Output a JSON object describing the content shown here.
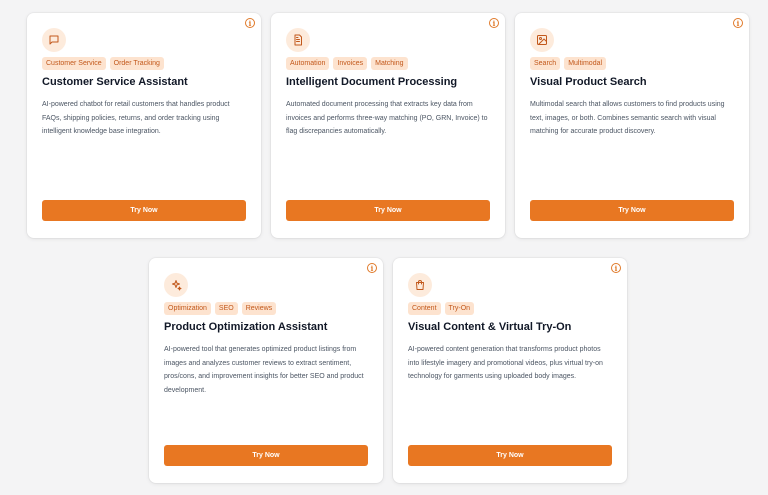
{
  "cards": [
    {
      "icon": "chat-bubble-icon",
      "tags": [
        "Customer Service",
        "Order Tracking"
      ],
      "title": "Customer Service Assistant",
      "description": "AI-powered chatbot for retail customers that handles product FAQs, shipping policies, returns, and order tracking using intelligent knowledge base integration.",
      "button": "Try Now",
      "info": "i"
    },
    {
      "icon": "document-icon",
      "tags": [
        "Automation",
        "Invoices",
        "Matching"
      ],
      "title": "Intelligent Document Processing",
      "description": "Automated document processing that extracts key data from invoices and performs three-way matching (PO, GRN, Invoice) to flag discrepancies automatically.",
      "button": "Try Now",
      "info": "i"
    },
    {
      "icon": "image-icon",
      "tags": [
        "Search",
        "Multimodal"
      ],
      "title": "Visual Product Search",
      "description": "Multimodal search that allows customers to find products using text, images, or both. Combines semantic search with visual matching for accurate product discovery.",
      "button": "Try Now",
      "info": "i"
    },
    {
      "icon": "sparkles-icon",
      "tags": [
        "Optimization",
        "SEO",
        "Reviews"
      ],
      "title": "Product Optimization Assistant",
      "description": "AI-powered tool that generates optimized product listings from images and analyzes customer reviews to extract sentiment, pros/cons, and improvement insights for better SEO and product development.",
      "button": "Try Now",
      "info": "i"
    },
    {
      "icon": "shopping-bag-icon",
      "tags": [
        "Content",
        "Try-On"
      ],
      "title": "Visual Content & Virtual Try-On",
      "description": "AI-powered content generation that transforms product photos into lifestyle imagery and promotional videos, plus virtual try-on technology for garments using uploaded body images.",
      "button": "Try Now",
      "info": "i"
    }
  ],
  "colors": {
    "accent": "#e87722",
    "tag_bg": "#fde3cf",
    "tag_text": "#c2581b",
    "icon_bg": "#fdebdc",
    "page_bg": "#f4f4f5"
  }
}
